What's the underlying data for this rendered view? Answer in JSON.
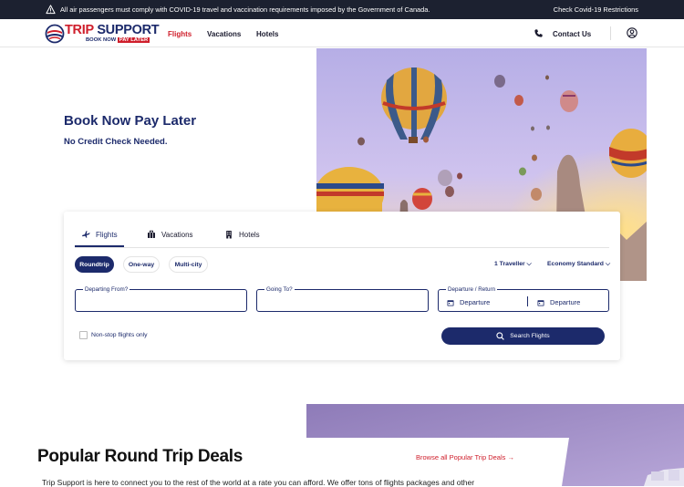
{
  "topbar": {
    "message": "All air passengers must comply with COVID-19 travel and vaccination requirements imposed by the Government of Canada.",
    "link": "Check Covid-19 Restrictions"
  },
  "header": {
    "logo": {
      "word1": "TRIP",
      "word2": "SUPPORT",
      "tag1": "BOOK NOW",
      "tag2": "PAY LATER"
    },
    "nav": [
      {
        "label": "Flights",
        "active": true
      },
      {
        "label": "Vacations",
        "active": false
      },
      {
        "label": "Hotels",
        "active": false
      }
    ],
    "contact": "Contact Us"
  },
  "hero": {
    "title": "Book Now Pay Later",
    "subtitle": "No Credit Check Needed."
  },
  "search": {
    "tabs": [
      {
        "label": "Flights",
        "icon": "plane-icon",
        "active": true
      },
      {
        "label": "Vacations",
        "icon": "suitcase-icon",
        "active": false
      },
      {
        "label": "Hotels",
        "icon": "building-icon",
        "active": false
      }
    ],
    "trip_types": [
      {
        "label": "Roundtrip",
        "active": true
      },
      {
        "label": "One-way",
        "active": false
      },
      {
        "label": "Multi-city",
        "active": false
      }
    ],
    "travellers": "1 Traveller",
    "cabin": "Economy Standard",
    "from_label": "Departing From?",
    "to_label": "Going To?",
    "dates_label": "Departure / Return",
    "departure": "Departure",
    "return": "Departure",
    "nonstop": "Non-stop flights only",
    "button": "Search Flights"
  },
  "deals": {
    "title": "Popular Round Trip Deals",
    "browse": "Browse all Popular Trip Deals →",
    "text": "Trip Support is here to connect you to the rest of the world at a rate you can afford. We offer tons of flights packages and other"
  },
  "colors": {
    "brand_blue": "#1c2a6b",
    "brand_red": "#cf1e2b",
    "topbar": "#1c2130"
  }
}
